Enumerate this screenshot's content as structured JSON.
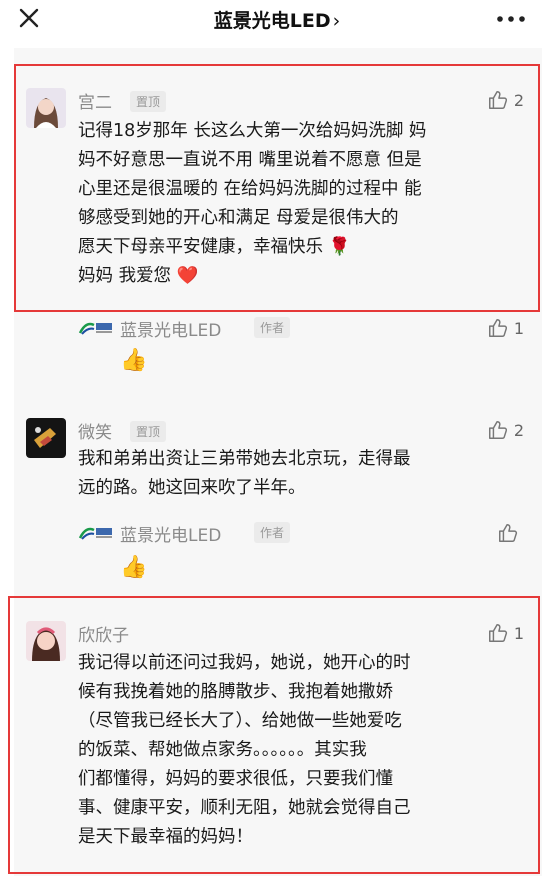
{
  "header": {
    "title": "蓝景光电LED",
    "chevron": "›",
    "close_icon": "close-icon",
    "more_icon": "more-icon"
  },
  "comments": [
    {
      "name": "宫二",
      "tag": "置顶",
      "likes": "2",
      "text": "记得18岁那年 长这么大第一次给妈妈洗脚 妈\n妈不好意思一直说不用  嘴里说着不愿意 但是\n心里还是很温暖的 在给妈妈洗脚的过程中 能\n够感受到她的开心和满足  母爱是很伟大的\n愿天下母亲平安健康，幸福快乐 🌹\n妈妈 我爱您 ❤️",
      "reply": {
        "name": "蓝景光电LED",
        "tag": "作者",
        "likes": "1",
        "emoji": "👍"
      }
    },
    {
      "name": "微笑",
      "tag": "置顶",
      "likes": "2",
      "text": "我和弟弟出资让三弟带她去北京玩，走得最\n远的路。她这回来吹了半年。",
      "reply": {
        "name": "蓝景光电LED",
        "tag": "作者",
        "likes": "",
        "emoji": "👍"
      }
    },
    {
      "name": "欣欣子",
      "tag": "",
      "likes": "1",
      "text": "我记得以前还问过我妈，她说，她开心的时\n候有我挽着她的胳膊散步、我抱着她撒娇\n（尽管我已经长大了）、给她做一些她爱吃\n的饭菜、帮她做点家务。。。。。。其实我\n们都懂得，妈妈的要求很低，只要我们懂\n事、健康平安，顺利无阻，她就会觉得自己\n是天下最幸福的妈妈！"
    }
  ],
  "colors": {
    "highlight": "#e53939",
    "name": "#8a8a8a",
    "background": "#f7f7f7"
  }
}
